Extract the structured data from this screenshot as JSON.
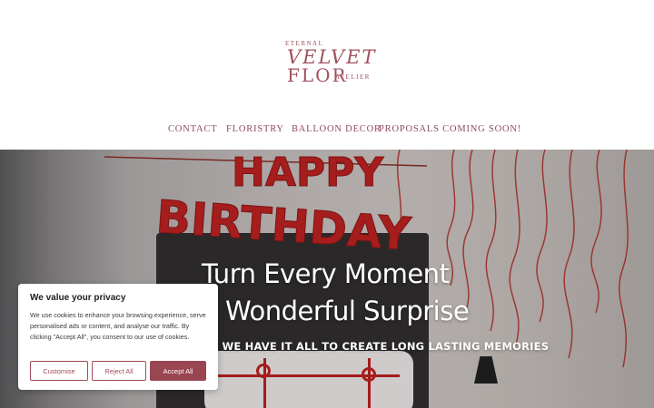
{
  "logo": {
    "line1": "ETERNAL",
    "line2": "VELVET",
    "line3": "FLOR",
    "line4": "ATELIER"
  },
  "nav": {
    "items": [
      {
        "label": "CONTACT"
      },
      {
        "label": "FLORISTRY"
      },
      {
        "label": "BALLOON DECOR"
      },
      {
        "label": "PROPOSALS COMING SOON!"
      }
    ]
  },
  "hero": {
    "headline_line1": "Turn Every Moment",
    "headline_line2": "a Wonderful Surprise",
    "subheadline": "NS WE HAVE IT ALL TO CREATE LONG LASTING MEMORIES",
    "balloon_text": "HAPPY BIRTHDAY"
  },
  "cookie": {
    "title": "We value your privacy",
    "body": "We use cookies to enhance your browsing experience, serve personalised ads or content, and analyse our traffic. By clicking \"Accept All\", you consent to our use of cookies.",
    "customise_label": "Customise",
    "reject_label": "Reject All",
    "accept_label": "Accept All"
  },
  "colors": {
    "brand": "#a0525e",
    "nav_text": "#8e4b57",
    "accept_button": "#9a4552",
    "balloon_red": "#c21d1d"
  }
}
